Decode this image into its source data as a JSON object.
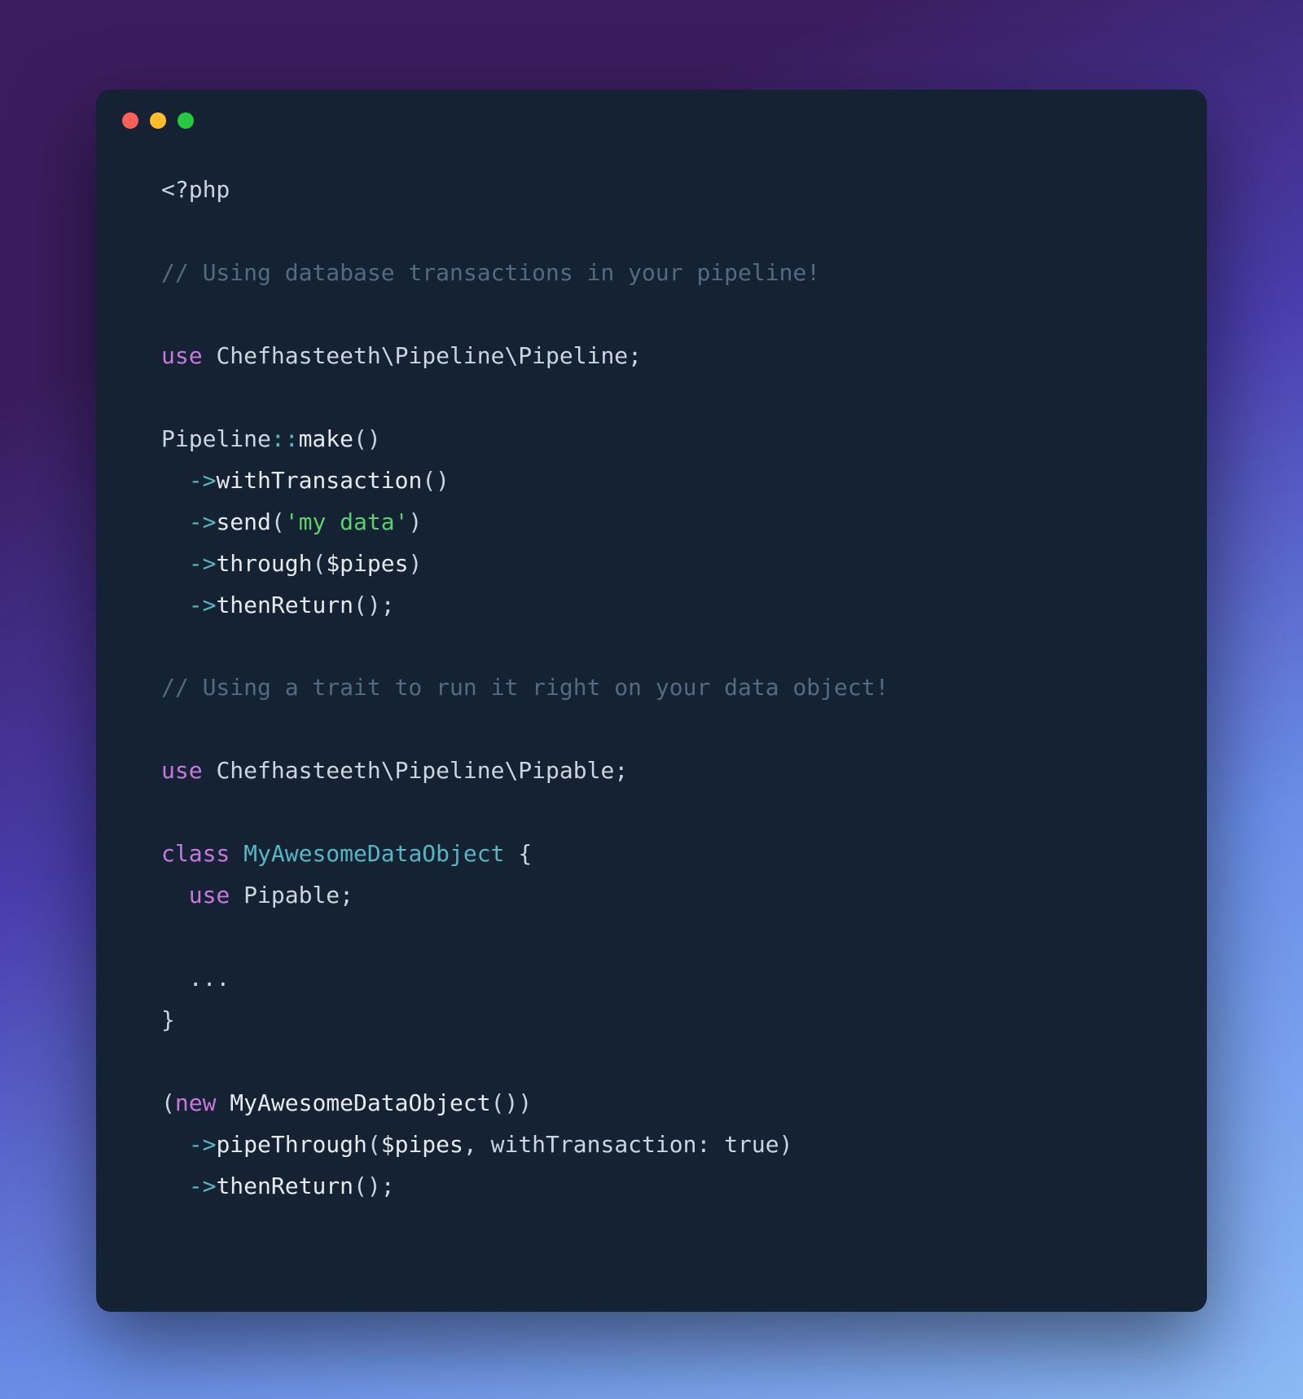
{
  "code": {
    "openTag": "<?php",
    "comment1": "// Using database transactions in your pipeline!",
    "useKw": "use",
    "ns1": "Chefhasteeth\\Pipeline\\Pipeline",
    "semi": ";",
    "pipelineClass": "Pipeline",
    "dblColon": "::",
    "make": "make",
    "parens": "()",
    "arrow": "->",
    "withTransaction": "withTransaction",
    "send": "send",
    "openParen": "(",
    "closeParen": ")",
    "myData": "'my data'",
    "through": "through",
    "pipesVar": "$pipes",
    "thenReturn": "thenReturn",
    "comment2": "// Using a trait to run it right on your data object!",
    "ns2": "Chefhasteeth\\Pipeline\\Pipable",
    "classKw": "class",
    "className": "MyAwesomeDataObject",
    "openBrace": "{",
    "closeBrace": "}",
    "pipable": "Pipable",
    "dots": "...",
    "newKw": "new",
    "pipeThrough": "pipeThrough",
    "comma": ", ",
    "namedArg": "withTransaction:",
    "trueVal": "true"
  }
}
